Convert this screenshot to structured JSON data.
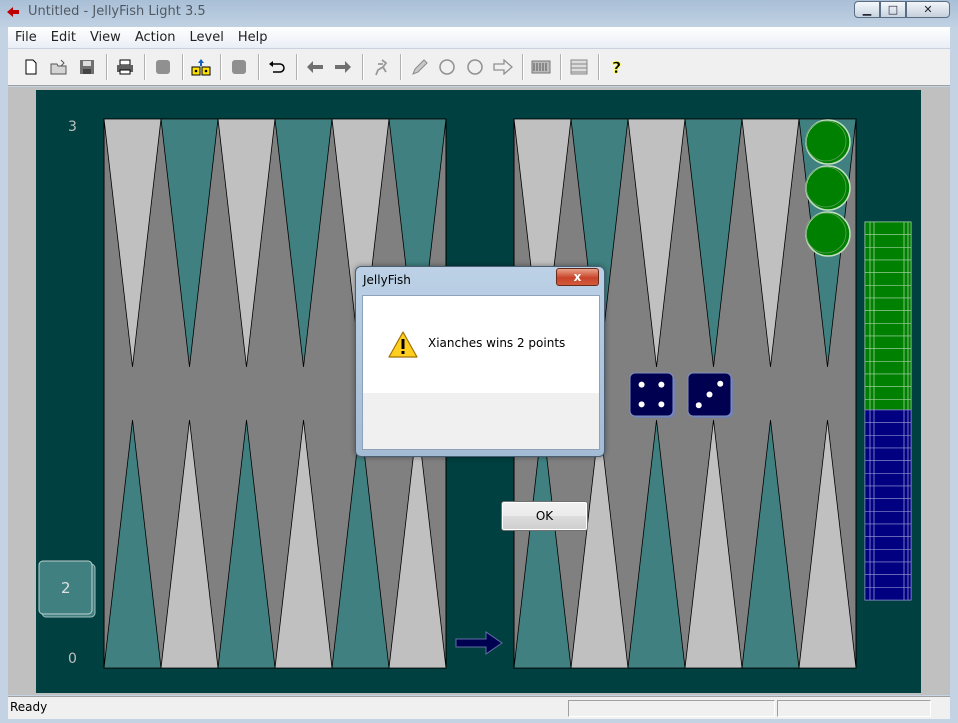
{
  "window": {
    "title": "Untitled - JellyFish Light 3.5",
    "controls": {
      "minimize": "▁",
      "maximize": "□",
      "close": "✕"
    }
  },
  "menu": {
    "items": [
      "File",
      "Edit",
      "View",
      "Action",
      "Level",
      "Help"
    ]
  },
  "toolbar": {
    "icons": [
      "new-icon",
      "open-icon",
      "save-icon",
      "sep",
      "print-icon",
      "sep",
      "stop-icon",
      "sep",
      "roll-dice-icon",
      "sep",
      "stop2-icon",
      "sep",
      "undo-icon",
      "sep",
      "back-arrow-icon",
      "forward-arrow-icon",
      "sep",
      "hint-icon",
      "sep",
      "pencil-icon",
      "circle-icon",
      "circle2-icon",
      "right-arrow-outline-icon",
      "sep",
      "board-icon",
      "sep",
      "grid-icon",
      "sep",
      "help-icon"
    ]
  },
  "board": {
    "colors": {
      "frame": "#014040",
      "bed": "#808080",
      "light_point": "#c0c0c0",
      "dark_point": "#408080",
      "green_checker": "#008000",
      "blue_checker": "#000080",
      "die": "#000050"
    },
    "top_left_number": "3",
    "bottom_left_number": "0",
    "cube_value": "2",
    "dice": [
      4,
      3
    ],
    "green_checkers_on_point": 3,
    "green_checkers_borne_off": 15,
    "blue_checkers_borne_off": 15
  },
  "dialog": {
    "title": "JellyFish",
    "close_label": "x",
    "message": "Xianches wins 2 points",
    "ok_label": "OK"
  },
  "status": {
    "text": "Ready"
  }
}
